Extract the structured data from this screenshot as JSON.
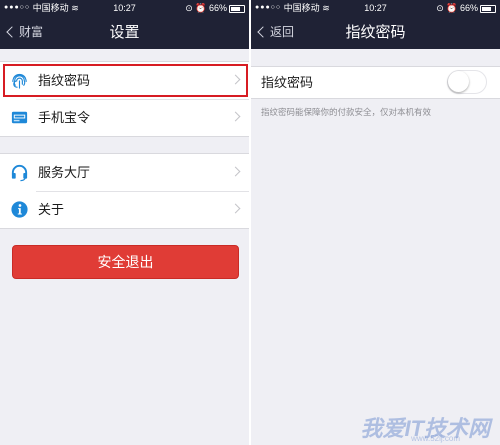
{
  "status_bar": {
    "carrier": "中国移动",
    "time": "10:27",
    "battery": "66%"
  },
  "left_screen": {
    "nav": {
      "back_label": "财富",
      "title": "设置"
    },
    "group1": [
      {
        "label": "指纹密码",
        "icon": "fingerprint-icon"
      },
      {
        "label": "手机宝令",
        "icon": "token-card-icon"
      }
    ],
    "group2": [
      {
        "label": "服务大厅",
        "icon": "headset-icon"
      },
      {
        "label": "关于",
        "icon": "info-icon"
      }
    ],
    "logout_label": "安全退出"
  },
  "right_screen": {
    "nav": {
      "back_label": "返回",
      "title": "指纹密码"
    },
    "toggle_row_label": "指纹密码",
    "toggle_on": false,
    "hint": "指纹密码能保障你的付款安全，仅对本机有效"
  },
  "watermark": {
    "text": "我爱IT技术网",
    "url": "www.52ij.com"
  },
  "colors": {
    "nav_bg": "#1f2235",
    "accent_red": "#e03c36",
    "icon_blue": "#1e88d8",
    "background": "#efeff4"
  }
}
